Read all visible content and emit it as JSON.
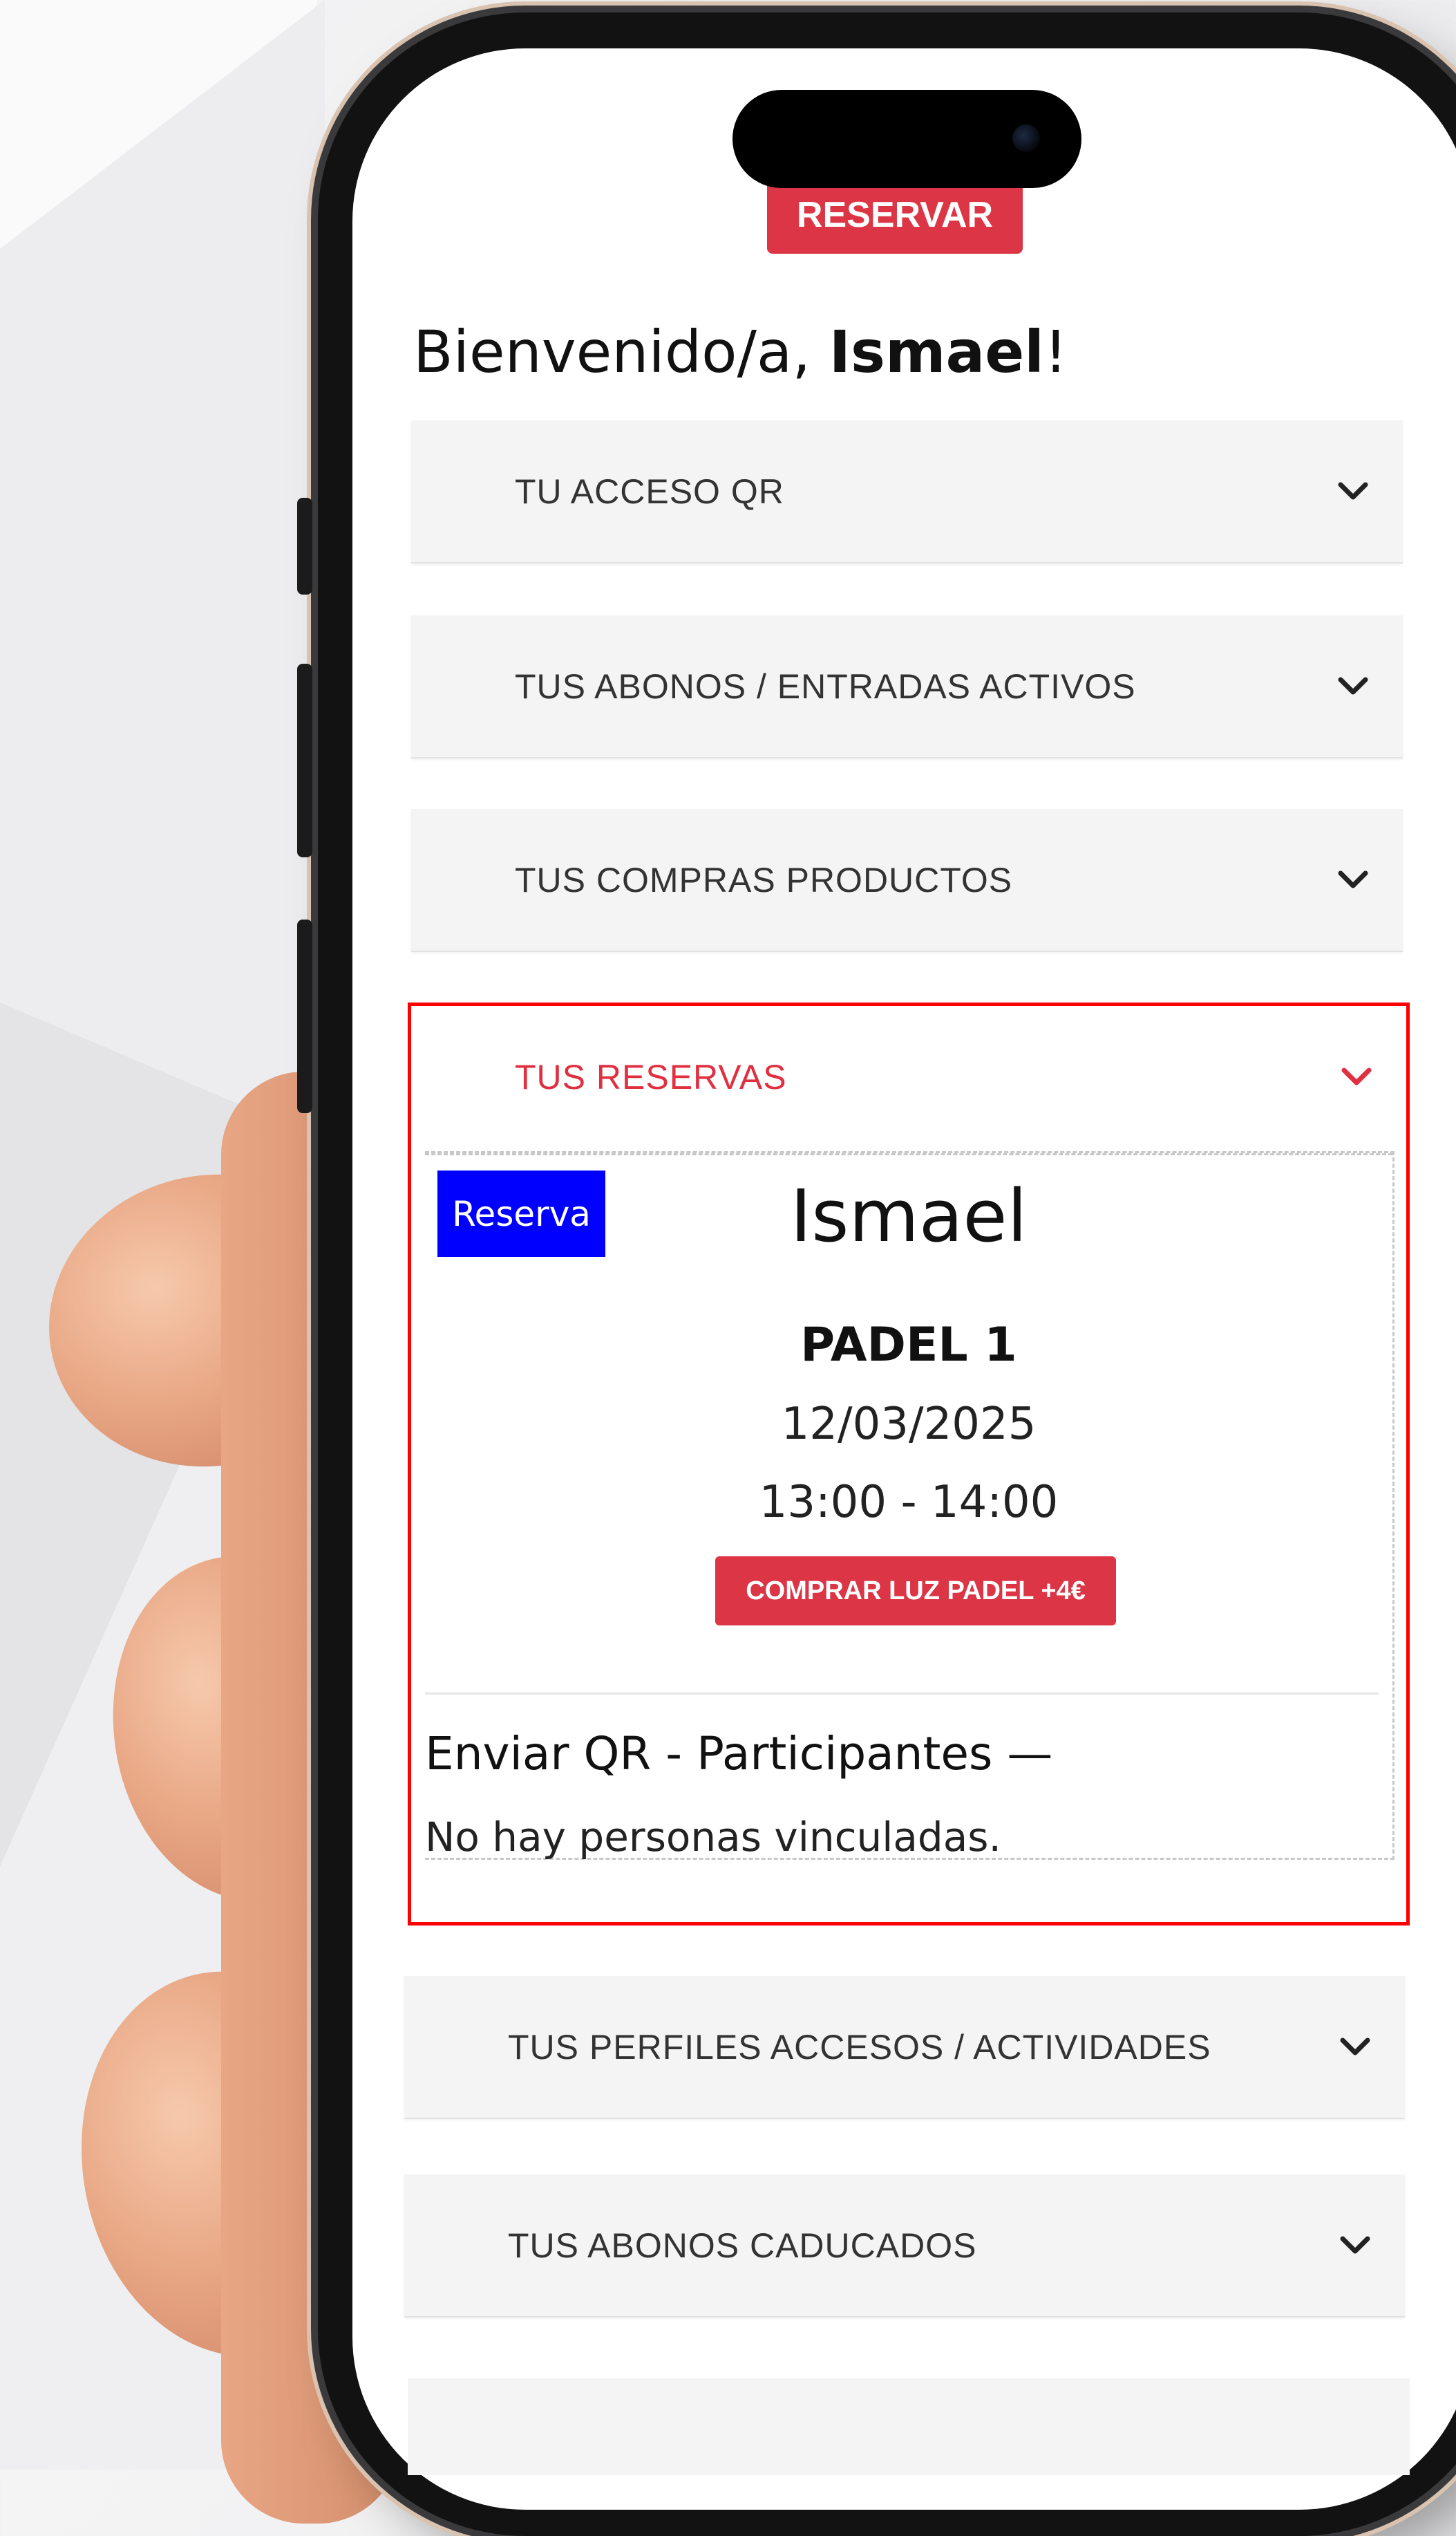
{
  "colors": {
    "accent_red": "#dc3545",
    "highlight_border": "#ff0000",
    "badge_blue": "#0000ff",
    "panel_bg": "#f4f4f4",
    "active_label": "#e03040"
  },
  "header": {
    "reserve_button": "RESERVAR",
    "welcome_prefix": "Bienvenido/a, ",
    "user_name": "Ismael",
    "welcome_suffix": "!"
  },
  "panels": [
    {
      "label": "TU ACCESO QR",
      "expanded": false,
      "icon": "chevron-down-icon"
    },
    {
      "label": "TUS ABONOS / ENTRADAS ACTIVOS",
      "expanded": false,
      "icon": "chevron-down-icon"
    },
    {
      "label": "TUS COMPRAS PRODUCTOS",
      "expanded": false,
      "icon": "chevron-down-icon"
    },
    {
      "label": "TUS RESERVAS",
      "expanded": true,
      "icon": "chevron-down-icon"
    },
    {
      "label": "TUS PERFILES ACCESOS / ACTIVIDADES",
      "expanded": false,
      "icon": "chevron-down-icon"
    },
    {
      "label": "TUS ABONOS CADUCADOS",
      "expanded": false,
      "icon": "chevron-down-icon"
    }
  ],
  "reservation": {
    "badge": "Reserva",
    "name": "Ismael",
    "court": "PADEL 1",
    "date": "12/03/2025",
    "time": "13:00 - 14:00",
    "buy_button": "COMPRAR LUZ PADEL +4€",
    "participants_title": "Enviar QR - Participantes —",
    "participants_empty": "No hay personas vinculadas."
  }
}
